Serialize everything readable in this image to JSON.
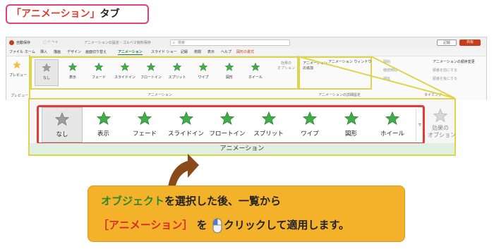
{
  "title": {
    "bracket_open": "「",
    "tab_name": "アニメーション",
    "bracket_close": "」",
    "suffix": "タブ"
  },
  "window": {
    "autosave": "自動保存",
    "doc_title": "アニメーションの設定・ゴルベマ資料保存",
    "search_placeholder": "検索",
    "record_label": "記録",
    "share_label": "共有"
  },
  "menu": [
    "ファイル",
    "ホーム",
    "挿入",
    "描画",
    "デザイン",
    "画面切り替え",
    "アニメーション",
    "スライド ショー",
    "記録",
    "校閲",
    "表示",
    "ヘルプ",
    "図形の書式"
  ],
  "ribbon": {
    "preview_label": "プレビュー",
    "preview_group": "プレビュー",
    "animation_group": "アニメーション",
    "effects_label": "効果の\nオプション",
    "add_animation": "アニメーション\nの追加",
    "advanced_group": "アニメーションの詳細設定",
    "animation_window": "アニメーション ウィンドウ",
    "start": "開始",
    "duration": "継続時間",
    "delay": "遅延",
    "timing_group": "タイミング",
    "reorder_title": "アニメーションの順序変更",
    "earlier": "順番を前にする",
    "later": "順番を後にする"
  },
  "gallery": {
    "items": [
      {
        "label": "なし",
        "color": "#9e9e9e",
        "selected": true
      },
      {
        "label": "表示",
        "color": "#3fae49",
        "selected": false
      },
      {
        "label": "フェード",
        "color": "#3fae49",
        "selected": false
      },
      {
        "label": "スライドイン",
        "color": "#3fae49",
        "selected": false
      },
      {
        "label": "フロートイン",
        "color": "#3fae49",
        "selected": false
      },
      {
        "label": "スプリット",
        "color": "#3fae49",
        "selected": false
      },
      {
        "label": "ワイプ",
        "color": "#3fae49",
        "selected": false
      },
      {
        "label": "図形",
        "color": "#3fae49",
        "selected": false
      },
      {
        "label": "ホイール",
        "color": "#3fae49",
        "selected": false
      }
    ],
    "group_label": "アニメーション",
    "effect_options": "効果の\nオプション"
  },
  "callout": {
    "line1_green": "オブジェクト",
    "line1_rest": "を選択した後、一覧から",
    "line2_red": "［アニメーション］",
    "line2_mid": "を",
    "line2_end": "クリックして適用します。"
  },
  "colors": {
    "accent_red": "#e53935",
    "zoom_frame": "#e0d54a",
    "callout_bg": "#f3b22a",
    "star_green": "#3fae49",
    "title_border": "#e0407e"
  }
}
